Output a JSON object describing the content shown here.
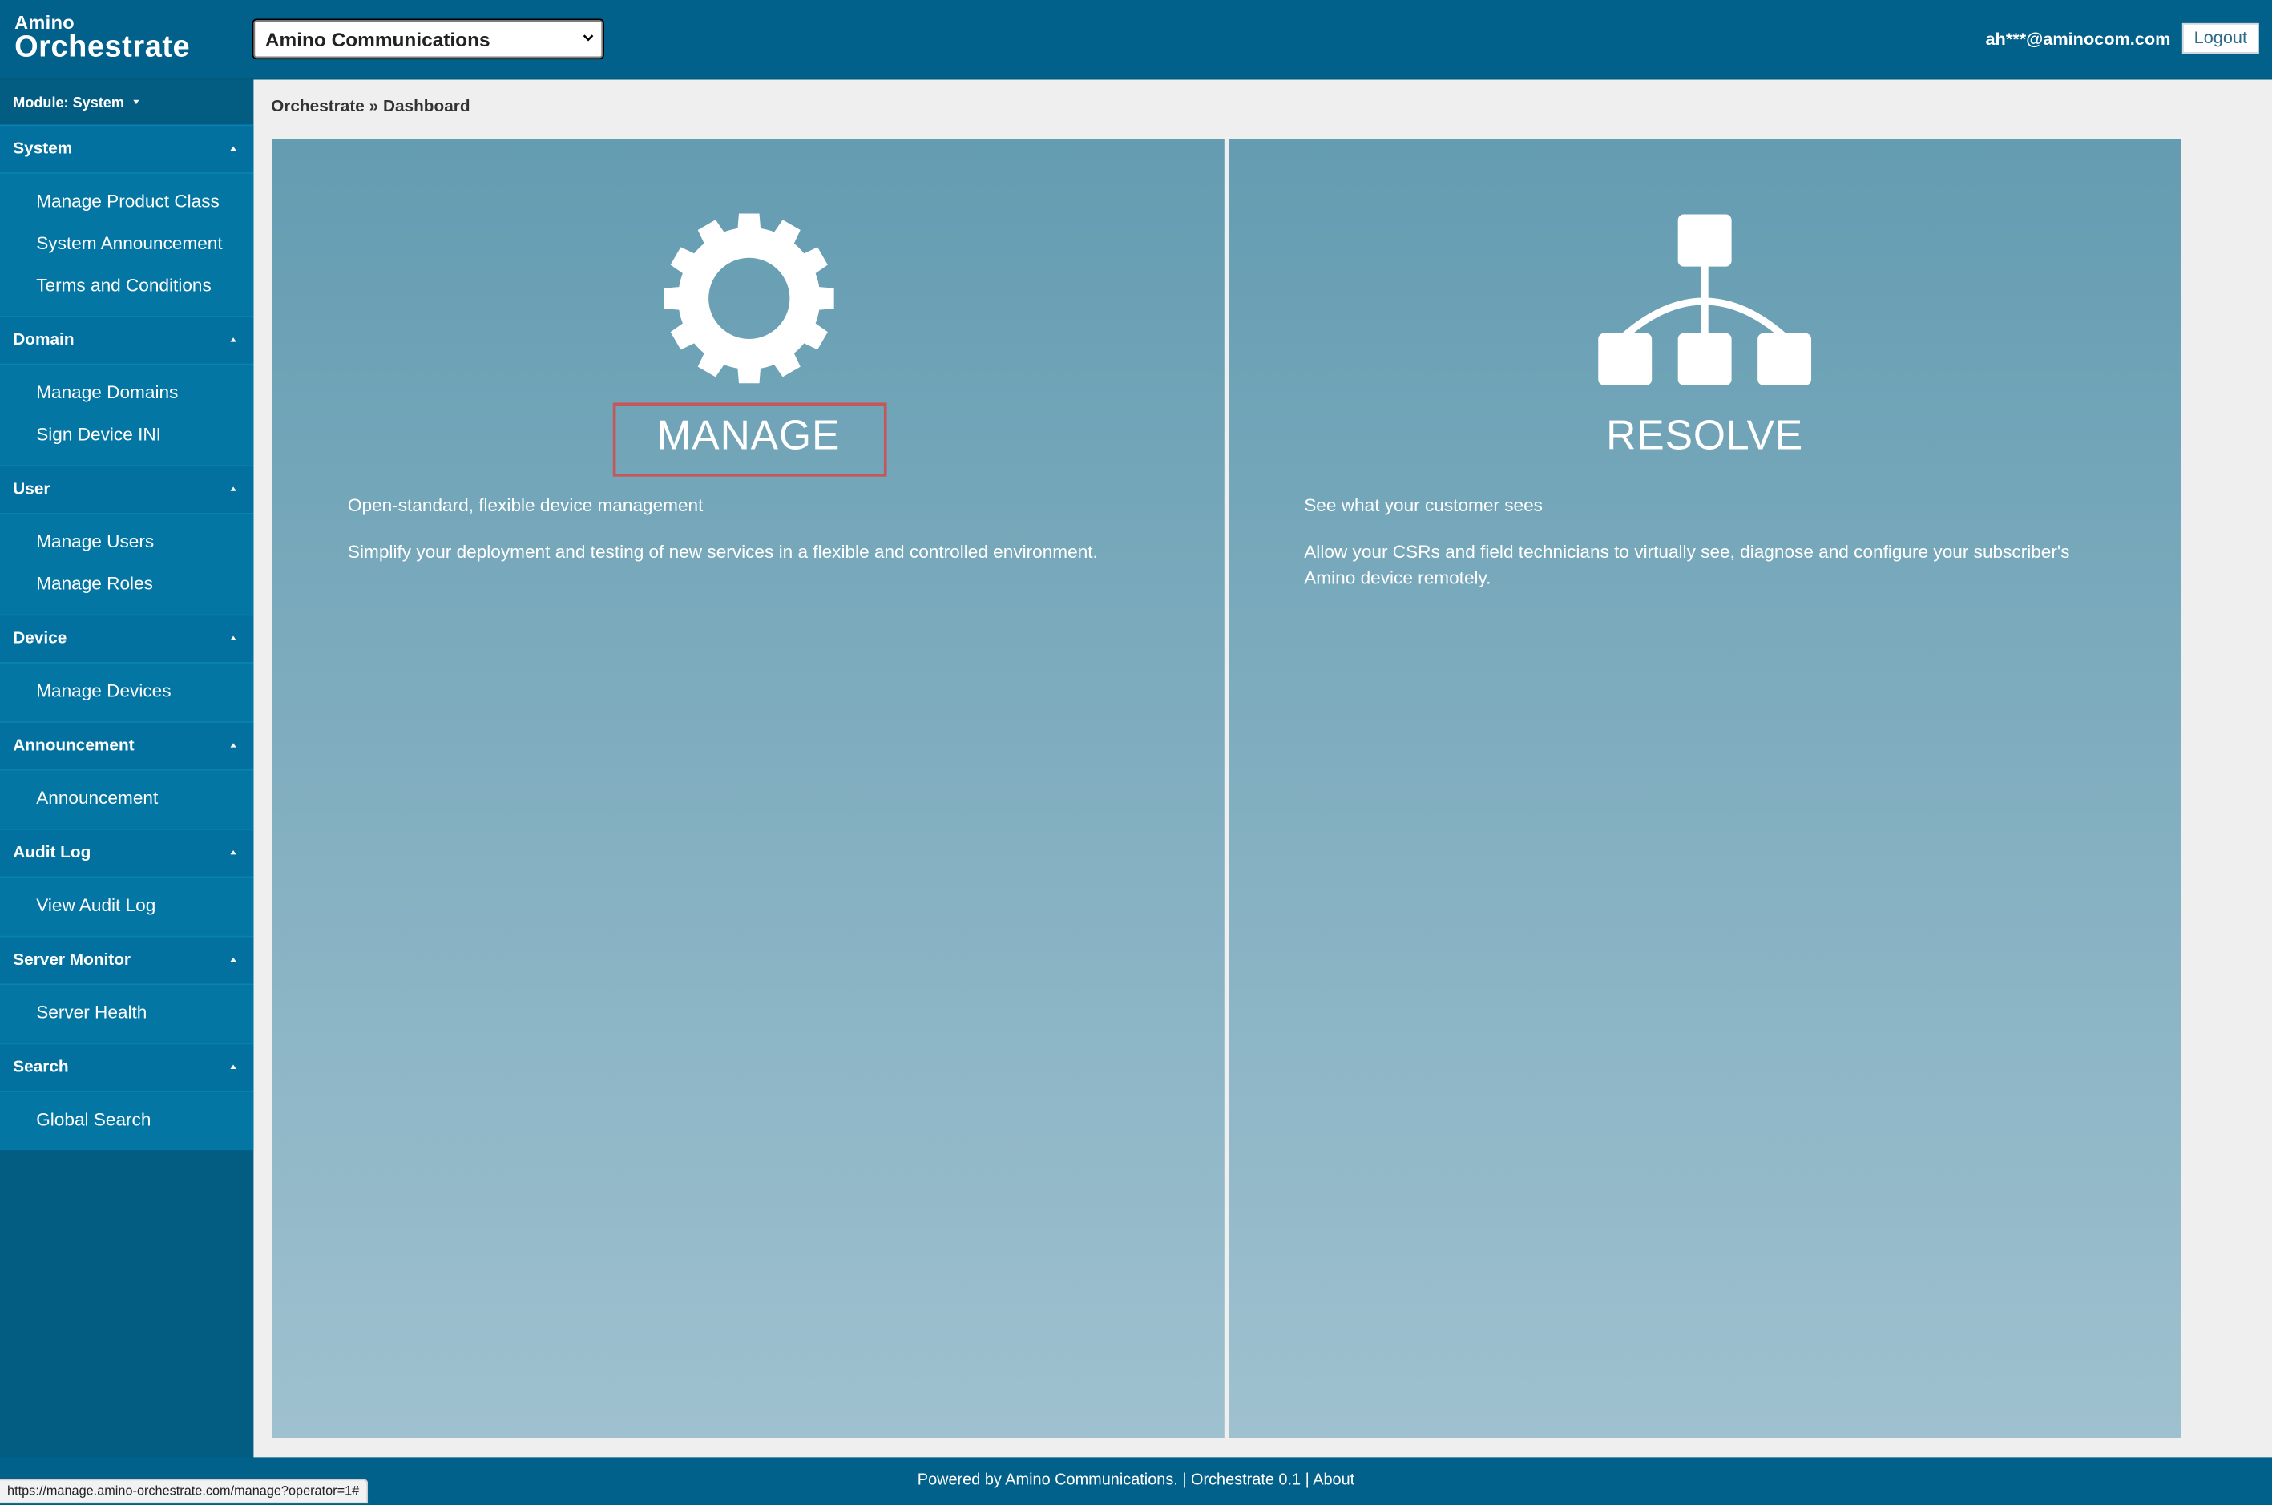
{
  "header": {
    "logo_small": "Amino",
    "logo_big": "Orchestrate",
    "org_selector": "Amino Communications",
    "user_email": "ah***@aminocom.com",
    "logout_label": "Logout",
    "brand_color": "#02618a"
  },
  "sidebar": {
    "module_label": "Module: System",
    "sections": [
      {
        "title": "System",
        "items": [
          "Manage Product Class",
          "System Announcement",
          "Terms and Conditions"
        ]
      },
      {
        "title": "Domain",
        "items": [
          "Manage Domains",
          "Sign Device INI"
        ]
      },
      {
        "title": "User",
        "items": [
          "Manage Users",
          "Manage Roles"
        ]
      },
      {
        "title": "Device",
        "items": [
          "Manage Devices"
        ]
      },
      {
        "title": "Announcement",
        "items": [
          "Announcement"
        ]
      },
      {
        "title": "Audit Log",
        "items": [
          "View Audit Log"
        ]
      },
      {
        "title": "Server Monitor",
        "items": [
          "Server Health"
        ]
      },
      {
        "title": "Search",
        "items": [
          "Global Search"
        ]
      }
    ]
  },
  "breadcrumb": "Orchestrate » Dashboard",
  "panels": {
    "manage": {
      "icon": "gear-icon",
      "title": "MANAGE",
      "tagline": "Open-standard, flexible device management",
      "description": "Simplify your deployment and testing of new services in a flexible and controlled environment."
    },
    "resolve": {
      "icon": "hierarchy-icon",
      "title": "RESOLVE",
      "tagline": "See what your customer sees",
      "description": "Allow your CSRs and field technicians to virtually see, diagnose and configure your subscriber's Amino device remotely."
    }
  },
  "footer": {
    "text": "Powered by Amino Communications. | Orchestrate 0.1 | About"
  },
  "status_bar": {
    "url": "https://manage.amino-orchestrate.com/manage?operator=1#"
  }
}
